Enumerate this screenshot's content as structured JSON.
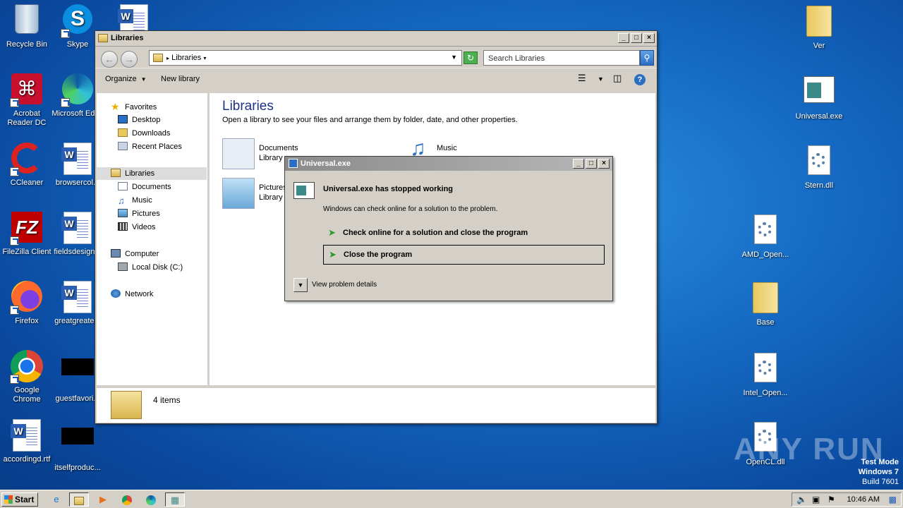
{
  "desktop": {
    "icons_left": [
      {
        "label": "Recycle Bin",
        "icon": "recycle-bin-icon"
      },
      {
        "label": "Skype",
        "icon": "skype-icon"
      },
      {
        "label": "Acrobat Reader DC",
        "icon": "acrobat-icon"
      },
      {
        "label": "Microsoft Edge",
        "icon": "edge-icon"
      },
      {
        "label": "CCleaner",
        "icon": "ccleaner-icon"
      },
      {
        "label": "browsercol...",
        "icon": "word-doc-icon"
      },
      {
        "label": "FileZilla Client",
        "icon": "filezilla-icon"
      },
      {
        "label": "fieldsdesign...",
        "icon": "word-doc-icon"
      },
      {
        "label": "Firefox",
        "icon": "firefox-icon"
      },
      {
        "label": "greatgreate...",
        "icon": "word-doc-icon"
      },
      {
        "label": "Google Chrome",
        "icon": "chrome-icon"
      },
      {
        "label": "guestfavori...",
        "icon": "blacked-out-icon"
      },
      {
        "label": "accordingd.rtf",
        "icon": "word-doc-icon"
      },
      {
        "label": "itselfproduc...",
        "icon": "blacked-out-icon"
      }
    ],
    "icons_right": [
      {
        "label": "Ver",
        "icon": "folder-icon"
      },
      {
        "label": "Universal.exe",
        "icon": "exe-icon"
      },
      {
        "label": "Stern.dll",
        "icon": "dll-icon"
      },
      {
        "label": "AMD_Open...",
        "icon": "dll-icon"
      },
      {
        "label": "Base",
        "icon": "folder-icon"
      },
      {
        "label": "Intel_Open...",
        "icon": "dll-icon"
      },
      {
        "label": "OpenCL.dll",
        "icon": "dll-icon"
      }
    ]
  },
  "explorer": {
    "title": "Libraries",
    "address": "Libraries",
    "search_placeholder": "Search Libraries",
    "toolbar": {
      "organize": "Organize",
      "new_library": "New library"
    },
    "nav": {
      "favorites": "Favorites",
      "desktop": "Desktop",
      "downloads": "Downloads",
      "recent": "Recent Places",
      "libraries": "Libraries",
      "documents": "Documents",
      "music": "Music",
      "pictures": "Pictures",
      "videos": "Videos",
      "computer": "Computer",
      "local_disk": "Local Disk (C:)",
      "network": "Network"
    },
    "heading": "Libraries",
    "subheading": "Open a library to see your files and arrange them by folder, date, and other properties.",
    "libraries": [
      {
        "name": "Documents",
        "type": "Library"
      },
      {
        "name": "Music",
        "type": ""
      },
      {
        "name": "Pictures",
        "type": "Library"
      }
    ],
    "status": "4 items"
  },
  "dialog": {
    "title": "Universal.exe",
    "heading": "Universal.exe has stopped working",
    "message": "Windows can check online for a solution to the problem.",
    "option_check": "Check online for a solution and close the program",
    "option_close": "Close the program",
    "details": "View problem details"
  },
  "watermark": {
    "brand": "ANY RUN",
    "mode": "Test Mode",
    "os": "Windows 7",
    "build": "Build 7601"
  },
  "taskbar": {
    "start": "Start",
    "clock": "10:46 AM"
  }
}
